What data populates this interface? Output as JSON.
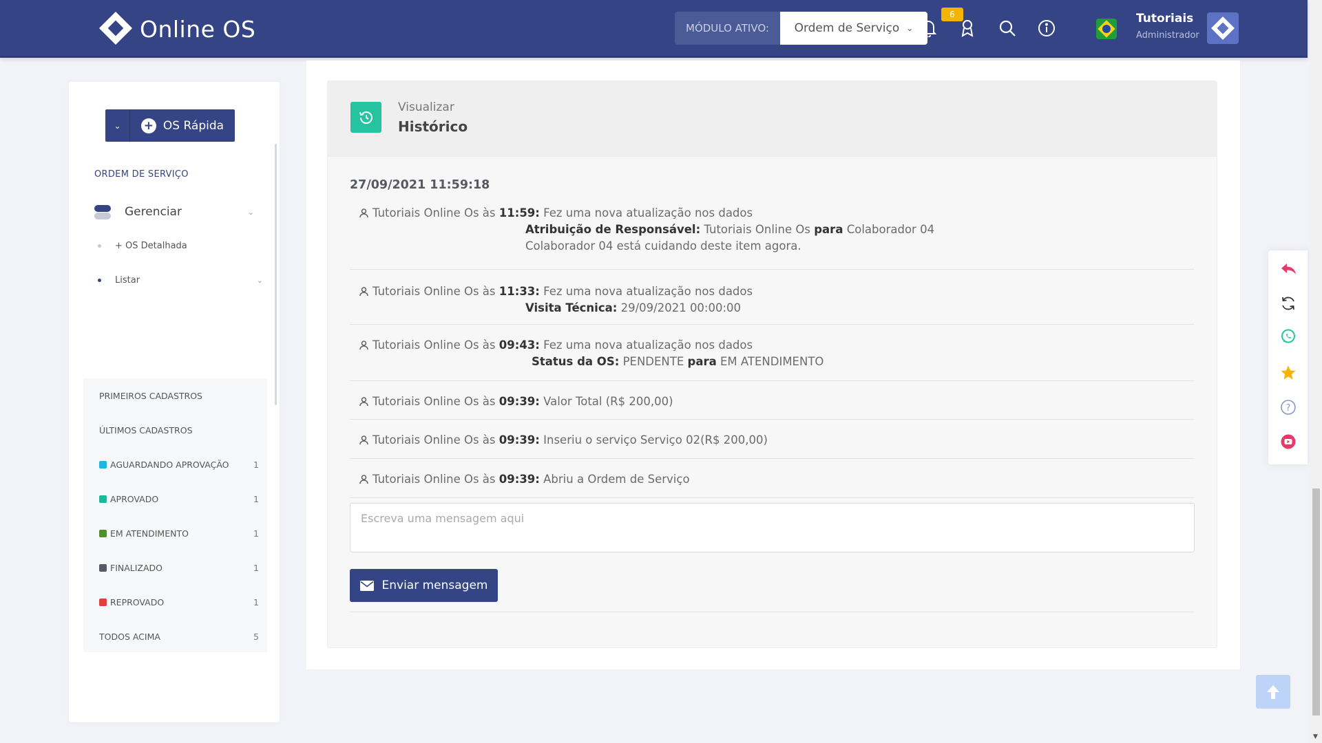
{
  "header": {
    "logo_text": "Online OS",
    "module_label": "MÓDULO ATIVO:",
    "module_value": "Ordem de Serviço",
    "notif_count": "6",
    "user_name": "Tutoriais",
    "user_role": "Administrador"
  },
  "sidebar": {
    "quick_button": "OS Rápida",
    "section_title": "ORDEM DE SERVIÇO",
    "manage_label": "Gerenciar",
    "sub_detailed": "+ OS Detalhada",
    "sub_list": "Listar",
    "list": [
      {
        "label": "PRIMEIROS CADASTROS",
        "count": "",
        "color": ""
      },
      {
        "label": "ÚLTIMOS CADASTROS",
        "count": "",
        "color": ""
      },
      {
        "label": "AGUARDANDO APROVAÇÃO",
        "count": "1",
        "color": "#1fb5e0"
      },
      {
        "label": "APROVADO",
        "count": "1",
        "color": "#1fb89a"
      },
      {
        "label": "EM ATENDIMENTO",
        "count": "1",
        "color": "#4f8f2f"
      },
      {
        "label": "FINALIZADO",
        "count": "1",
        "color": "#555c66"
      },
      {
        "label": "REPROVADO",
        "count": "1",
        "color": "#e0403a"
      },
      {
        "label": "TODOS ACIMA",
        "count": "5",
        "color": ""
      }
    ]
  },
  "history": {
    "subtitle": "Visualizar",
    "title": "Histórico",
    "date": "27/09/2021 11:59:18",
    "entries": [
      {
        "prefix": "Tutoriais Online Os às",
        "time": "11:59:",
        "text": "Fez uma nova atualização nos dados",
        "d1_label": "Atribuição de Responsável:",
        "d1_from": "Tutoriais Online Os",
        "d1_para": "para",
        "d1_to": "Colaborador 04",
        "d2": "Colaborador 04 está cuidando deste item agora."
      },
      {
        "prefix": "Tutoriais Online Os às",
        "time": "11:33:",
        "text": "Fez uma nova atualização nos dados",
        "d1_label": "Visita Técnica:",
        "d1_value": "29/09/2021 00:00:00"
      },
      {
        "prefix": "Tutoriais Online Os às",
        "time": "09:43:",
        "text": "Fez uma nova atualização nos dados",
        "d1_label": "Status da OS:",
        "d1_from": "PENDENTE",
        "d1_para": "para",
        "d1_to": "EM ATENDIMENTO"
      },
      {
        "prefix": "Tutoriais Online Os às",
        "time": "09:39:",
        "text": "Valor Total (R$ 200,00)"
      },
      {
        "prefix": "Tutoriais Online Os às",
        "time": "09:39:",
        "text": "Inseriu o serviço Serviço 02(R$ 200,00)"
      },
      {
        "prefix": "Tutoriais Online Os às",
        "time": "09:39:",
        "text": "Abriu a Ordem de Serviço"
      }
    ],
    "message_placeholder": "Escreva uma mensagem aqui",
    "send_label": "Enviar mensagem"
  },
  "icons": {
    "reply": "reply-icon",
    "refresh": "refresh-icon",
    "whatsapp": "whatsapp-icon",
    "star": "star-icon",
    "help": "help-icon",
    "youtube": "youtube-icon"
  },
  "colors": {
    "primary": "#344485",
    "accent_teal": "#25c3a0",
    "badge": "#f4b400"
  }
}
